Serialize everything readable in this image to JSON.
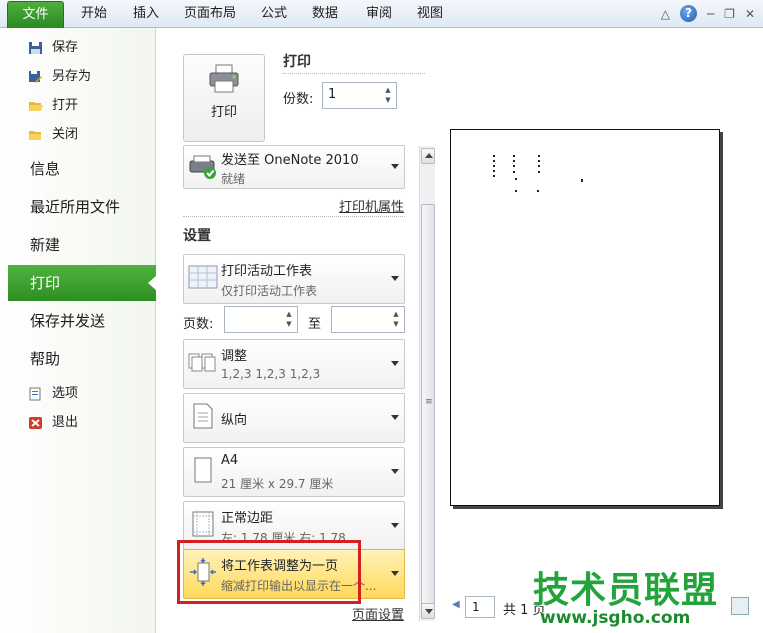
{
  "ribbon": {
    "file_tab": "文件",
    "tabs": [
      "开始",
      "插入",
      "页面布局",
      "公式",
      "数据",
      "审阅",
      "视图"
    ]
  },
  "nav": {
    "save": "保存",
    "save_as": "另存为",
    "open": "打开",
    "close": "关闭",
    "info": "信息",
    "recent": "最近所用文件",
    "new": "新建",
    "print": "打印",
    "save_send": "保存并发送",
    "help": "帮助",
    "options": "选项",
    "exit": "退出"
  },
  "print": {
    "section_title": "打印",
    "button_label": "打印",
    "copies_label": "份数:",
    "copies_value": "1",
    "printer_name": "发送至 OneNote 2010",
    "printer_status": "就绪",
    "printer_props_link": "打印机属性",
    "settings_title": "设置",
    "what_title": "打印活动工作表",
    "what_sub": "仅打印活动工作表",
    "pages_label": "页数:",
    "pages_to": "至",
    "collate_title": "调整",
    "collate_sub": "1,2,3    1,2,3    1,2,3",
    "orientation": "纵向",
    "paper_title": "A4",
    "paper_sub": "21 厘米 x 29.7 厘米",
    "margins_title": "正常边距",
    "margins_sub": "左: 1.78 厘米    右: 1.78 ...",
    "scaling_title": "将工作表调整为一页",
    "scaling_sub": "缩减打印输出以显示在一个...",
    "page_setup_link": "页面设置"
  },
  "preview": {
    "page_value": "1",
    "page_of": "共 1 页"
  },
  "watermark": {
    "text": "技术员联盟",
    "url": "www.jsgho.com"
  }
}
